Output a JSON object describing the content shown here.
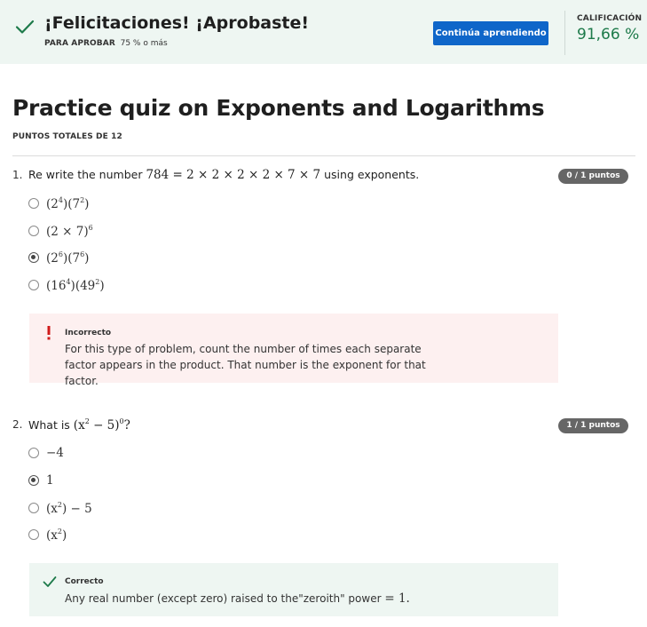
{
  "banner": {
    "title": "¡Felicitaciones! ¡Aprobaste!",
    "pass_label": "PARA APROBAR",
    "pass_value": "75 % o más",
    "continue_label": "Continúa aprendiendo",
    "grade_label": "CALIFICACIÓN",
    "grade_value": "91,66 %"
  },
  "quiz": {
    "title": "Practice quiz on Exponents and Logarithms",
    "total_points": "PUNTOS TOTALES DE 12"
  },
  "questions": [
    {
      "number": "1.",
      "text_before": "Re write the number",
      "math": "784 = 2 × 2 × 2 × 2 × 7 × 7",
      "text_after": "using exponents.",
      "points": "0 / 1 puntos",
      "options": [
        {
          "base1": "(2",
          "exp1": "4",
          "mid": ")(7",
          "exp2": "2",
          "end": ")",
          "selected": false
        },
        {
          "base1": "(2 × 7)",
          "exp1": "6",
          "mid": "",
          "exp2": "",
          "end": "",
          "selected": false
        },
        {
          "base1": "(2",
          "exp1": "6",
          "mid": ")(7",
          "exp2": "6",
          "end": ")",
          "selected": true
        },
        {
          "base1": "(16",
          "exp1": "4",
          "mid": ")(49",
          "exp2": "2",
          "end": ")",
          "selected": false
        }
      ],
      "feedback": {
        "status": "Incorrecto",
        "body": "For this type of problem, count the number of times each separate factor appears in the product. That number is the exponent for that factor."
      }
    },
    {
      "number": "2.",
      "text_before": "What is",
      "math_base": "(x",
      "math_exp": "2",
      "math_mid": " − 5)",
      "math_exp2": "0",
      "math_end": "?",
      "points": "1 / 1 puntos",
      "options": [
        {
          "base1": "−4",
          "exp1": "",
          "mid": "",
          "exp2": "",
          "end": "",
          "selected": false
        },
        {
          "base1": "1",
          "exp1": "",
          "mid": "",
          "exp2": "",
          "end": "",
          "selected": true
        },
        {
          "base1": "(x",
          "exp1": "2",
          "mid": ") − 5",
          "exp2": "",
          "end": "",
          "selected": false
        },
        {
          "base1": "(x",
          "exp1": "2",
          "mid": ")",
          "exp2": "",
          "end": "",
          "selected": false
        }
      ],
      "feedback": {
        "status": "Correcto",
        "body_text": "Any real number (except zero) raised to the\"zeroith\" power",
        "body_math": "= 1."
      }
    }
  ],
  "colors": {
    "accent": "#0f66c9",
    "success": "#1d7a4a",
    "error": "#d01a1a"
  }
}
